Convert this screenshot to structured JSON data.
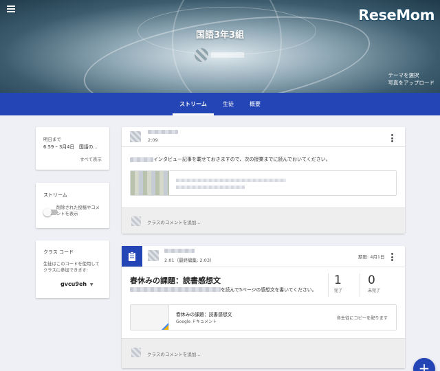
{
  "header": {
    "class_name": "国語3年3組",
    "logo_text": "ReseMom",
    "theme_select": "テーマを選択",
    "upload_photo": "写真をアップロード"
  },
  "tabs": [
    {
      "label": "ストリーム",
      "active": true
    },
    {
      "label": "生徒",
      "active": false
    },
    {
      "label": "概要",
      "active": false
    }
  ],
  "upcoming": {
    "due_label": "明日まで",
    "item": "6:59 – 3月4日　国語の...",
    "view_all": "すべて表示"
  },
  "stream_settings": {
    "title": "ストリーム",
    "toggle_label_1": "削除された投稿やコメ",
    "toggle_label_2": "ントを表示",
    "toggle_on": false
  },
  "class_code": {
    "title": "クラス コード",
    "desc_1": "生徒はこのコードを使用して",
    "desc_2": "クラスに参加できます:",
    "code": "gvcu9eh"
  },
  "post1": {
    "time": "2:09",
    "body": "インタビュー記事を載せておきますので、次の授業までに読んでおいてください。",
    "comment_placeholder": "クラスのコメントを追加..."
  },
  "post2": {
    "time": "2:01（最終編集: 2:03）",
    "due": "期限: 4月1日",
    "title": "春休みの課題：読書感想文",
    "instruction": "を読んで5ページの感想文を書いてください。",
    "turned_in_count": "1",
    "turned_in_label": "完了",
    "not_done_count": "0",
    "not_done_label": "未完了",
    "attachment_title": "春休みの課題：読書感想文",
    "attachment_type": "Google ドキュメント",
    "attachment_mode": "各生徒にコピーを配ります",
    "comment_placeholder": "クラスのコメントを追加..."
  },
  "colors": {
    "primary": "#2345b5",
    "background": "#eef0f5"
  },
  "fab_label": "+"
}
